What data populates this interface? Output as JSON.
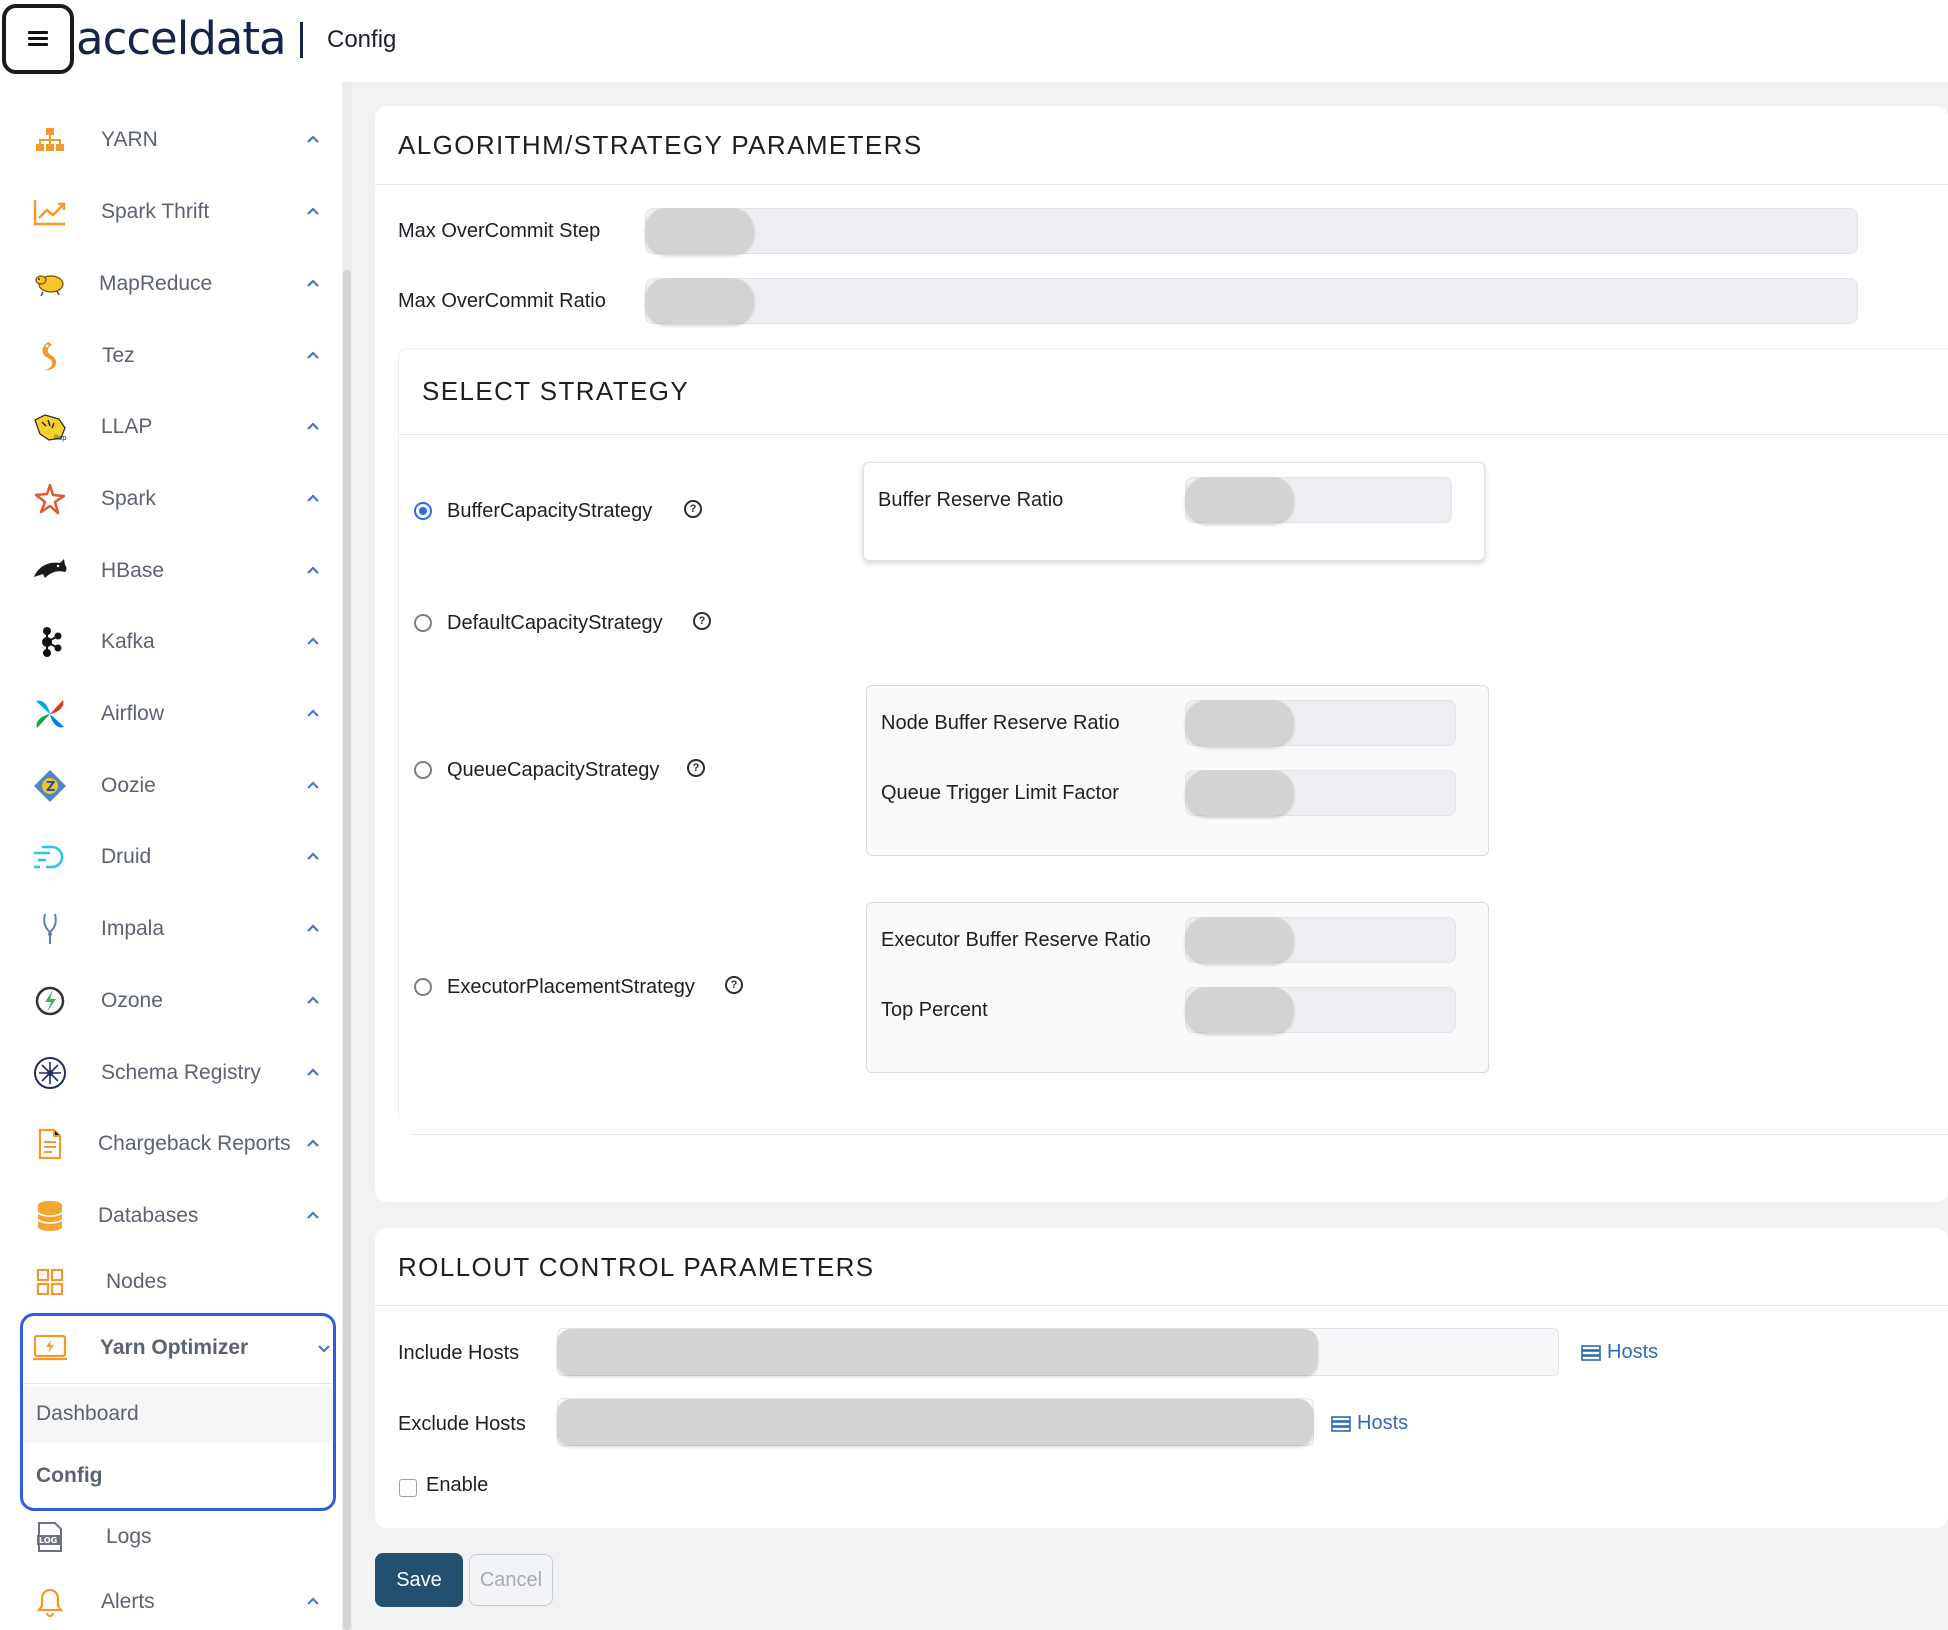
{
  "header": {
    "menu_icon": "hamburger-icon",
    "brand": "acceldata",
    "page": "Config"
  },
  "sidebar": {
    "items": [
      {
        "label": "YARN",
        "icon": "yarn-icon"
      },
      {
        "label": "Spark Thrift",
        "icon": "spark-thrift-icon"
      },
      {
        "label": "MapReduce",
        "icon": "mapreduce-icon"
      },
      {
        "label": "Tez",
        "icon": "tez-icon"
      },
      {
        "label": "LLAP",
        "icon": "llap-icon"
      },
      {
        "label": "Spark",
        "icon": "spark-icon"
      },
      {
        "label": "HBase",
        "icon": "hbase-icon"
      },
      {
        "label": "Kafka",
        "icon": "kafka-icon"
      },
      {
        "label": "Airflow",
        "icon": "airflow-icon"
      },
      {
        "label": "Oozie",
        "icon": "oozie-icon"
      },
      {
        "label": "Druid",
        "icon": "druid-icon"
      },
      {
        "label": "Impala",
        "icon": "impala-icon"
      },
      {
        "label": "Ozone",
        "icon": "ozone-icon"
      },
      {
        "label": "Schema Registry",
        "icon": "schema-registry-icon"
      },
      {
        "label": "Chargeback Reports",
        "icon": "chargeback-reports-icon"
      },
      {
        "label": "Databases",
        "icon": "databases-icon"
      },
      {
        "label": "Nodes",
        "icon": "nodes-icon"
      }
    ],
    "yarn_optimizer": {
      "label": "Yarn Optimizer",
      "icon": "yarn-optimizer-icon",
      "sub_items": [
        "Dashboard",
        "Config"
      ],
      "active": "Config"
    },
    "after_items": [
      {
        "label": "Logs",
        "icon": "logs-icon"
      },
      {
        "label": "Alerts",
        "icon": "bell-icon"
      }
    ]
  },
  "algorithm": {
    "title": "ALGORITHM/STRATEGY PARAMETERS",
    "max_overcommit_step_label": "Max OverCommit Step",
    "max_overcommit_ratio_label": "Max OverCommit Ratio"
  },
  "strategy": {
    "title": "SELECT STRATEGY",
    "selected": "BufferCapacityStrategy",
    "options": [
      {
        "label": "BufferCapacityStrategy",
        "params": [
          "Buffer Reserve Ratio"
        ]
      },
      {
        "label": "DefaultCapacityStrategy",
        "params": []
      },
      {
        "label": "QueueCapacityStrategy",
        "params": [
          "Node Buffer Reserve Ratio",
          "Queue Trigger Limit Factor"
        ]
      },
      {
        "label": "ExecutorPlacementStrategy",
        "params": [
          "Executor Buffer Reserve Ratio",
          "Top Percent"
        ]
      }
    ]
  },
  "rollout": {
    "title": "ROLLOUT CONTROL PARAMETERS",
    "include_hosts_label": "Include Hosts",
    "exclude_hosts_label": "Exclude Hosts",
    "hosts_link": "Hosts",
    "enable_label": "Enable",
    "enable_checked": false
  },
  "actions": {
    "save": "Save",
    "cancel": "Cancel"
  },
  "colors": {
    "brand": "#16244a",
    "accent": "#2f5de0",
    "save_button": "#24506f",
    "link": "#2f6bb8"
  }
}
